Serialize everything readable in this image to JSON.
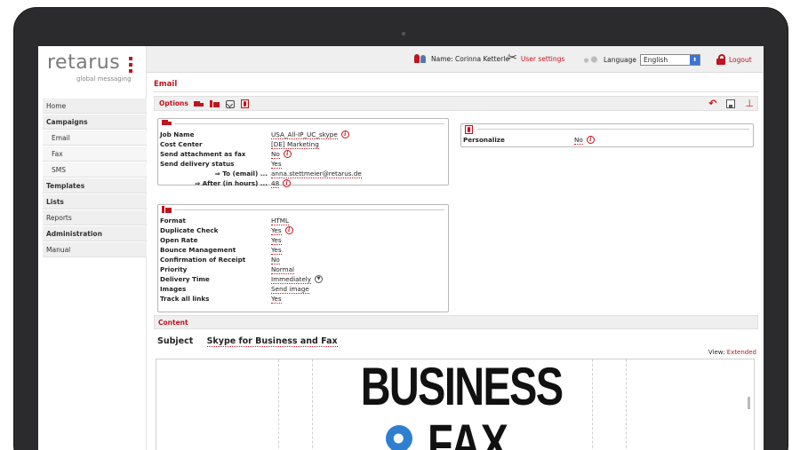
{
  "logo": {
    "text": "retarus",
    "subtitle": "global messaging"
  },
  "sidebar": {
    "items": [
      {
        "label": "Home",
        "bold": false,
        "sub": false
      },
      {
        "label": "Campaigns",
        "bold": true,
        "sub": false
      },
      {
        "label": "Email",
        "bold": false,
        "sub": true
      },
      {
        "label": "Fax",
        "bold": false,
        "sub": true
      },
      {
        "label": "SMS",
        "bold": false,
        "sub": true
      },
      {
        "label": "Templates",
        "bold": true,
        "sub": false
      },
      {
        "label": "Lists",
        "bold": true,
        "sub": false
      },
      {
        "label": "Reports",
        "bold": false,
        "sub": false
      },
      {
        "label": "Administration",
        "bold": true,
        "sub": false
      },
      {
        "label": "Manual",
        "bold": false,
        "sub": false
      }
    ]
  },
  "topbar": {
    "name_text": "Name: Corinna Ketterle",
    "user_settings": "User settings",
    "language_label": "Language",
    "language_value": "English",
    "logout": "Logout"
  },
  "page": {
    "title": "Email",
    "options_label": "Options",
    "content_label": "Content"
  },
  "job": {
    "rows": [
      {
        "key": "Job Name",
        "value": "USA_All-IP_UC_skype",
        "info": true
      },
      {
        "key": "Cost Center",
        "value": "[DE] Marketing",
        "info": false
      },
      {
        "key": "Send attachment as fax",
        "value": "No",
        "info": true
      },
      {
        "key": "Send delivery status",
        "value": "Yes",
        "info": false
      },
      {
        "key": "⇒ To (email) ...",
        "value": "anna.stettmeier@retarus.de",
        "info": false,
        "arrow": true
      },
      {
        "key": "⇒ After (in hours) ...",
        "value": "48",
        "info": true,
        "arrow": true
      }
    ]
  },
  "format": {
    "rows": [
      {
        "key": "Format",
        "value": "HTML"
      },
      {
        "key": "Duplicate Check",
        "value": "Yes",
        "info": true
      },
      {
        "key": "Open Rate",
        "value": "Yes"
      },
      {
        "key": "Bounce Management",
        "value": "Yes"
      },
      {
        "key": "Confirmation of Receipt",
        "value": "No"
      },
      {
        "key": "Priority",
        "value": "Normal"
      },
      {
        "key": "Delivery Time",
        "value": "Immediately",
        "drop": true
      },
      {
        "key": "Images",
        "value": "Send image"
      },
      {
        "key": "Track all links",
        "value": "Yes"
      }
    ]
  },
  "personalize": {
    "key": "Personalize",
    "value": "No"
  },
  "subject": {
    "label": "Subject",
    "value": "Skype for Business and Fax"
  },
  "view": {
    "label": "View:",
    "value": "Extended"
  },
  "preview": {
    "line1": "BUSINESS",
    "line2": "FAX"
  },
  "colors": {
    "accent": "#c0141e",
    "pin": "#2f7fd0"
  }
}
